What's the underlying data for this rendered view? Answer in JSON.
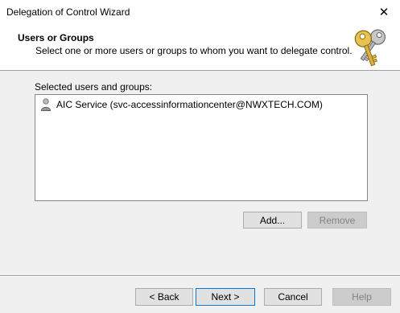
{
  "window": {
    "title": "Delegation of Control Wizard",
    "close_glyph": "✕"
  },
  "header": {
    "title": "Users or Groups",
    "subtitle": "Select one or more users or groups to whom you want to delegate control.",
    "icon": "keys-icon"
  },
  "main": {
    "list_label": "Selected users and groups:",
    "items": [
      {
        "icon": "user-icon",
        "label": "AIC Service (svc-accessinformationcenter@NWXTECH.COM)"
      }
    ],
    "add_label": "Add...",
    "remove_label": "Remove"
  },
  "footer": {
    "back_label": "< Back",
    "next_label": "Next >",
    "cancel_label": "Cancel",
    "help_label": "Help"
  }
}
